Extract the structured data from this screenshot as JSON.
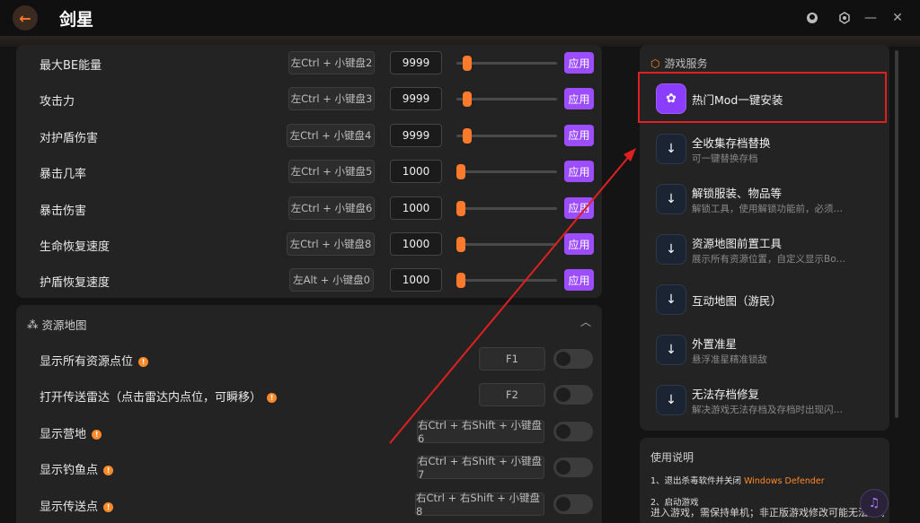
{
  "app": {
    "title": "剑星",
    "back_icon": "arrow-left-icon"
  },
  "stats": [
    {
      "label": "最大BE能量",
      "hotkey": "左Ctrl + 小键盘2",
      "value": "9999",
      "slider_level": 0.06,
      "apply": "应用"
    },
    {
      "label": "攻击力",
      "hotkey": "左Ctrl + 小键盘3",
      "value": "9999",
      "slider_level": 0.06,
      "apply": "应用"
    },
    {
      "label": "对护盾伤害",
      "hotkey": "左Ctrl + 小键盘4",
      "value": "9999",
      "slider_level": 0.06,
      "apply": "应用"
    },
    {
      "label": "暴击几率",
      "hotkey": "左Ctrl + 小键盘5",
      "value": "1000",
      "slider_level": 0.0,
      "apply": "应用"
    },
    {
      "label": "暴击伤害",
      "hotkey": "左Ctrl + 小键盘6",
      "value": "1000",
      "slider_level": 0.0,
      "apply": "应用"
    },
    {
      "label": "生命恢复速度",
      "hotkey": "左Ctrl + 小键盘8",
      "value": "1000",
      "slider_level": 0.0,
      "apply": "应用"
    },
    {
      "label": "护盾恢复速度",
      "hotkey": "左Alt + 小键盘0",
      "value": "1000",
      "slider_level": 0.0,
      "apply": "应用"
    }
  ],
  "resource_map": {
    "title": "资源地图",
    "items": [
      {
        "label": "显示所有资源点位",
        "hotkey": "F1",
        "enabled": false
      },
      {
        "label": "打开传送雷达（点击雷达内点位，可瞬移）",
        "hotkey": "F2",
        "enabled": false
      },
      {
        "label": "显示营地",
        "hotkey": "右Ctrl + 右Shift + 小键盘6",
        "enabled": false
      },
      {
        "label": "显示钓鱼点",
        "hotkey": "右Ctrl + 右Shift + 小键盘7",
        "enabled": false
      },
      {
        "label": "显示传送点",
        "hotkey": "右Ctrl + 右Shift + 小键盘8",
        "enabled": false
      }
    ]
  },
  "services": {
    "header": "游戏服务",
    "items": [
      {
        "title": "热门Mod一键安装",
        "desc": "",
        "icon": "mod-icon"
      },
      {
        "title": "全收集存档替换",
        "desc": "可一键替换存档",
        "icon": "download-icon"
      },
      {
        "title": "解锁服装、物品等",
        "desc": "解锁工具，使用解锁功能前，必须…",
        "icon": "download-icon"
      },
      {
        "title": "资源地图前置工具",
        "desc": "展示所有资源位置，自定义显示Bo…",
        "icon": "download-icon"
      },
      {
        "title": "互动地图（游民）",
        "desc": "",
        "icon": "download-icon"
      },
      {
        "title": "外置准星",
        "desc": "悬浮准星精准锁敌",
        "icon": "download-icon"
      },
      {
        "title": "无法存档修复",
        "desc": "解决游戏无法存档及存档时出现闪…",
        "icon": "download-icon"
      }
    ]
  },
  "usage": {
    "title": "使用说明",
    "step1_prefix": "1、退出杀毒软件并关闭 ",
    "step1_highlight": "Windows Defender",
    "step2": "2、启动游戏",
    "body": "进入游戏，需保持单机；非正版游戏修改可能无法生效"
  },
  "colors": {
    "accent": "#ff7a2a",
    "apply": "#9b4dff",
    "highlight": "#e02020"
  }
}
